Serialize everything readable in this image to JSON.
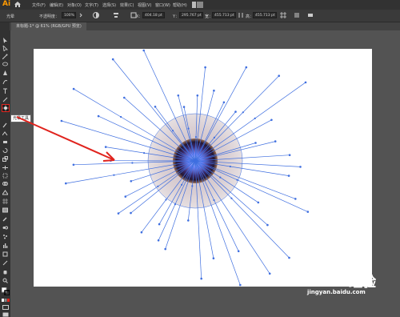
{
  "app": {
    "logo": "Ai",
    "menus": [
      "文件(F)",
      "编辑(E)",
      "对象(O)",
      "文字(T)",
      "选择(S)",
      "效果(C)",
      "视图(V)",
      "窗口(W)",
      "帮助(H)"
    ]
  },
  "control_bar": {
    "object_label": "光晕",
    "opacity_label": "不透明度：",
    "opacity_value": "100%",
    "x_label": "X：",
    "x_value": "404.18 pt",
    "y_label": "Y：",
    "y_value": "295.767 pt",
    "w_label": "宽：",
    "w_value": "455.713 pt",
    "h_label": "高：",
    "h_value": "455.713 pt"
  },
  "document": {
    "tab_title": "未标题-1* @ 61% (RGB/GPU 预览)"
  },
  "tooltip": "光晕工具",
  "watermark": {
    "brand": "Baidu经验",
    "url": "jingyan.baidu.com"
  },
  "colors": {
    "accent_red": "#e0231d",
    "path_blue": "#3f6fe0"
  }
}
